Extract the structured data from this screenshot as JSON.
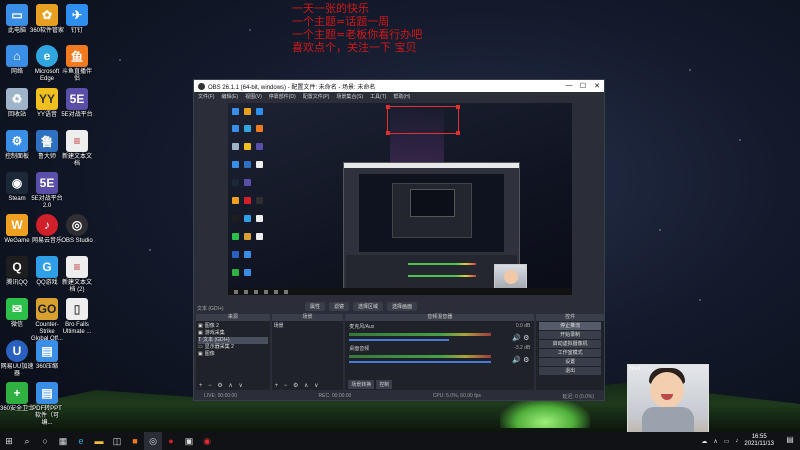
{
  "overlay": {
    "lines": [
      "一天一张的快乐",
      "一个主题=话题一周",
      "一个主题=老板你看行办吧",
      "喜欢点个，关注一下 宝贝"
    ]
  },
  "desktop_icons": [
    {
      "label": "此电脑",
      "icon": "computer-icon",
      "color": "#3a8ee6"
    },
    {
      "label": "360软件管家",
      "icon": "360-manager-icon",
      "color": "#e8a020"
    },
    {
      "label": "钉钉",
      "icon": "dingtalk-icon",
      "color": "#2f8ff0"
    },
    {
      "label": "网络",
      "icon": "network-icon",
      "color": "#3a8ee6"
    },
    {
      "label": "Microsoft Edge",
      "icon": "edge-icon",
      "color": "#2fa6e0"
    },
    {
      "label": "斗鱼直播伴侣",
      "icon": "douyu-icon",
      "color": "#f07a20"
    },
    {
      "label": "回收站",
      "icon": "recycle-bin-icon",
      "color": "#9fb4c8"
    },
    {
      "label": "YY语音",
      "icon": "yy-icon",
      "color": "#f0c020"
    },
    {
      "label": "5E对战平台",
      "icon": "5e-platform-icon",
      "color": "#5b4ea8"
    },
    {
      "label": "控制面板",
      "icon": "control-panel-icon",
      "color": "#3a8ee6"
    },
    {
      "label": "鲁大师",
      "icon": "ludashi-icon",
      "color": "#3070c0"
    },
    {
      "label": "新建文本文档",
      "icon": "text-file-icon",
      "color": "#eeeeee"
    },
    {
      "label": "Steam",
      "icon": "steam-icon",
      "color": "#1b2838"
    },
    {
      "label": "5E对战平台 2.0",
      "icon": "5e-platform-2-icon",
      "color": "#5b4ea8"
    },
    {
      "label": "WeGame",
      "icon": "wegame-icon",
      "color": "#f0a020"
    },
    {
      "label": "网易云音乐",
      "icon": "netease-music-icon",
      "color": "#d0202a"
    },
    {
      "label": "OBS Studio",
      "icon": "obs-icon",
      "color": "#302e31"
    },
    {
      "label": "腾讯QQ",
      "icon": "qq-icon",
      "color": "#1e1e1e"
    },
    {
      "label": "QQ游戏",
      "icon": "qq-game-icon",
      "color": "#2fa0e8"
    },
    {
      "label": "新建文本文档 (2)",
      "icon": "text-file-2-icon",
      "color": "#eeeeee"
    },
    {
      "label": "微信",
      "icon": "wechat-icon",
      "color": "#2cbf4a"
    },
    {
      "label": "Counter-Strike Global Off...",
      "icon": "csgo-icon",
      "color": "#d8a030"
    },
    {
      "label": "Bro Falls Ultimate ...",
      "icon": "bro-falls-icon",
      "color": "#eeeeee"
    },
    {
      "label": "网易UU加速器",
      "icon": "uu-booster-icon",
      "color": "#2a60c0"
    },
    {
      "label": "360压缩",
      "icon": "360-zip-icon",
      "color": "#3a8ee6"
    },
    {
      "label": "360安全卫士",
      "icon": "360-security-icon",
      "color": "#30b040"
    },
    {
      "label": "PDF转PPT软件（可编...",
      "icon": "pdf-ppt-icon",
      "color": "#3a8ee6"
    }
  ],
  "obs": {
    "title": "OBS 26.1.1 (64-bit, windows) - 配置文件: 未命名 - 场景: 未命名",
    "menu": [
      "文件(F)",
      "编辑(E)",
      "视图(V)",
      "停靠部件(D)",
      "配置文件(P)",
      "场景集合(S)",
      "工具(T)",
      "帮助(H)"
    ],
    "source_label": "文本 (GDI+)",
    "control_tabs": [
      "属性",
      "滤镜",
      "选择区域",
      "选择画面"
    ],
    "scenes_header": "来源",
    "sources": [
      "图像 2",
      "游戏采集",
      "文本 (GDI+)",
      "显示器采集 2",
      "图像"
    ],
    "scene_header": "场景",
    "scene_item": "场景",
    "mixer_header": "音频混音器",
    "mixer": [
      {
        "name": "麦克风/Aux",
        "db": "0.0 dB",
        "level": 0.55
      },
      {
        "name": "桌面音频",
        "db": "-3.2 dB",
        "level": 0.78
      }
    ],
    "mixer_tabs": [
      "场景转换",
      "控制"
    ],
    "controls_header": "控件",
    "controls": [
      "停止推流",
      "开始录制",
      "启动虚拟摄像机",
      "工作室模式",
      "设置",
      "退出"
    ],
    "status": {
      "live": "LIVE: 00:00:00",
      "rec": "REC: 00:00:00",
      "cpu": "CPU: 5.0%, 60.00 fps",
      "dropped": "延迟: 0 (0.0%)"
    },
    "dock_footer": "+ − ⚙ ∧ ∨"
  },
  "webcam": {
    "label": "Shot"
  },
  "taskbar": {
    "items": [
      "windows-start-icon",
      "search-icon",
      "task-view-icon",
      "widgets-icon",
      "edge-icon",
      "file-explorer-icon",
      "store-icon",
      "douyu-icon",
      "obs-icon",
      "netease-music-icon",
      "apps-icon",
      "weibo-icon"
    ],
    "time": "16:55",
    "date": "2021/11/13"
  }
}
